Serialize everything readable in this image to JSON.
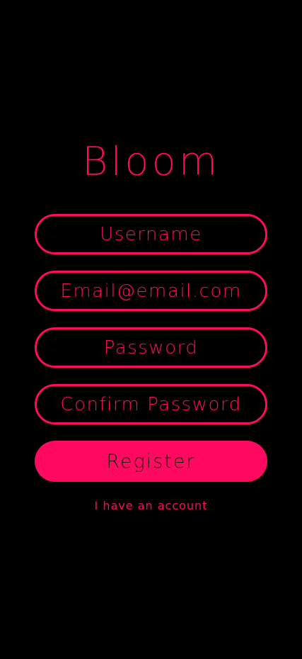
{
  "app": {
    "title": "Bloom"
  },
  "form": {
    "username_placeholder": "Username",
    "email_placeholder": "Email@email.com",
    "password_placeholder": "Password",
    "confirm_password_placeholder": "Confirm Password",
    "register_label": "Register",
    "login_link_label": "I have an account"
  },
  "colors": {
    "accent": "#ff0a60",
    "background": "#000000",
    "button_text": "#1a0008"
  }
}
